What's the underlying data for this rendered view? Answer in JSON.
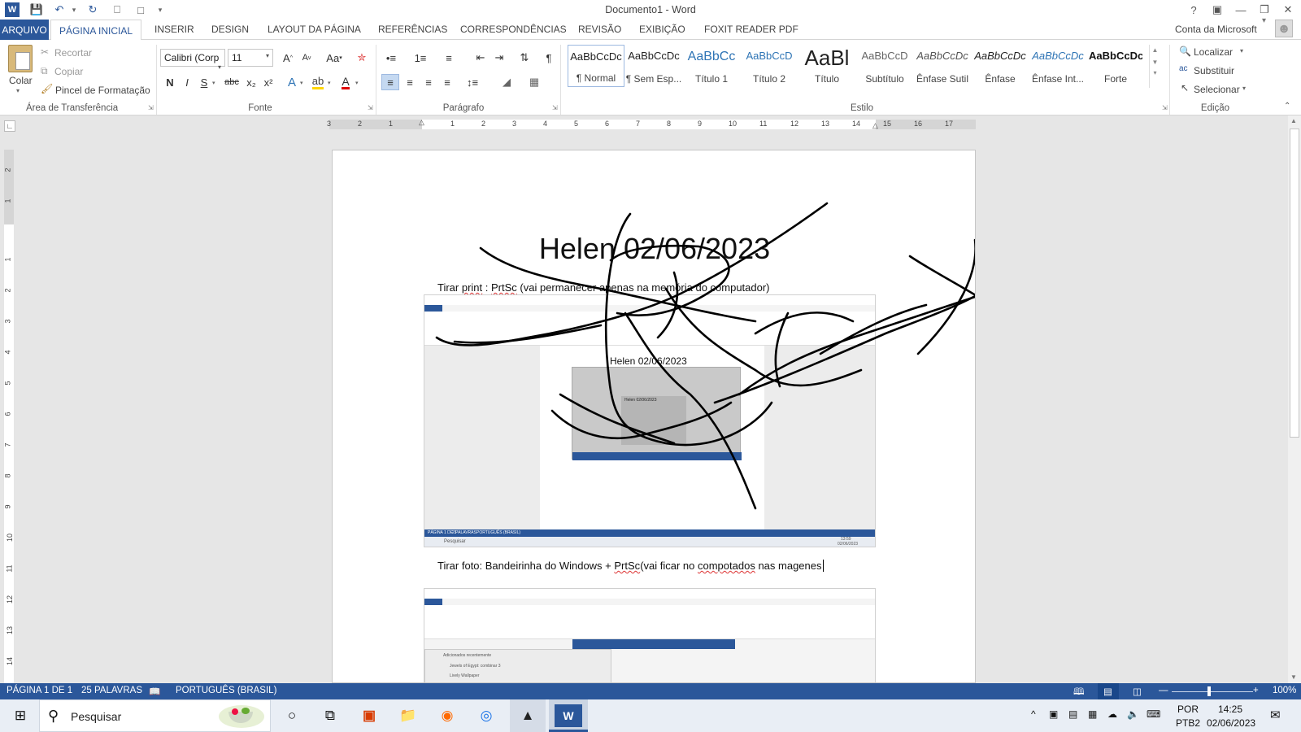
{
  "window": {
    "title": "Documento1 - Word",
    "help": "?",
    "qat": [
      "word-icon",
      "save-icon",
      "undo-icon",
      "redo-icon",
      "print-preview-icon",
      "new-doc-icon",
      "customize-icon"
    ]
  },
  "tabs": {
    "arquivo": "ARQUIVO",
    "items": [
      "PÁGINA INICIAL",
      "INSERIR",
      "DESIGN",
      "LAYOUT DA PÁGINA",
      "REFERÊNCIAS",
      "CORRESPONDÊNCIAS",
      "REVISÃO",
      "EXIBIÇÃO",
      "FOXIT READER PDF"
    ],
    "account": "Conta da Microsoft"
  },
  "ribbon": {
    "clipboard": {
      "paste": "Colar",
      "cut": "Recortar",
      "copy": "Copiar",
      "format_painter": "Pincel de Formatação",
      "group": "Área de Transferência"
    },
    "font": {
      "name": "Calibri (Corp",
      "size": "11",
      "bold": "N",
      "italic": "I",
      "underline": "S",
      "strike": "abc",
      "sub": "x₂",
      "sup": "x²",
      "case": "Aa",
      "group": "Fonte"
    },
    "paragraph": {
      "group": "Parágrafo"
    },
    "styles": {
      "group": "Estilo",
      "items": [
        {
          "sample": "AaBbCcDc",
          "name": "¶ Normal",
          "color": "#222222"
        },
        {
          "sample": "AaBbCcDc",
          "name": "¶ Sem Esp...",
          "color": "#222222"
        },
        {
          "sample": "AaBbCc",
          "name": "Título 1",
          "color": "#2e74b5"
        },
        {
          "sample": "AaBbCcD",
          "name": "Título 2",
          "color": "#2e74b5"
        },
        {
          "sample": "AaBl",
          "name": "Título",
          "color": "#222222"
        },
        {
          "sample": "AaBbCcD",
          "name": "Subtítulo",
          "color": "#666666"
        },
        {
          "sample": "AaBbCcDc",
          "name": "Ênfase Sutil",
          "color": "#555555"
        },
        {
          "sample": "AaBbCcDc",
          "name": "Ênfase",
          "color": "#222222"
        },
        {
          "sample": "AaBbCcDc",
          "name": "Ênfase Int...",
          "color": "#2e74b5"
        },
        {
          "sample": "AaBbCcDc",
          "name": "Forte",
          "color": "#111111"
        }
      ]
    },
    "editing": {
      "find": "Localizar",
      "replace": "Substituir",
      "select": "Selecionar",
      "group": "Edição"
    }
  },
  "ruler": {
    "h_ticks": [
      "3",
      "2",
      "1",
      "1",
      "2",
      "3",
      "4",
      "5",
      "6",
      "7",
      "8",
      "9",
      "10",
      "11",
      "12",
      "13",
      "14",
      "15",
      "16",
      "17"
    ],
    "v_ticks": [
      "2",
      "1",
      "1",
      "2",
      "3",
      "4",
      "5",
      "6",
      "7",
      "8",
      "9",
      "10",
      "11",
      "12",
      "13",
      "14"
    ]
  },
  "document": {
    "title": "Helen 02/06/2023",
    "line1_prefix": "Tirar ",
    "line1_print": "print",
    "line1_mid": " : ",
    "line1_prtsc": "PrtSc",
    "line1_rest": " (vai permanecer apenas na memória do computador)",
    "line2_prefix": "Tirar foto: Bandeirinha do Windows + ",
    "line2_prtsc": "PrtSc",
    "line2_mid": "(vai ficar no ",
    "line2_comp": "compotados",
    "line2_rest": " nas magenes",
    "embedded_title": "Helen 02/06/2023",
    "embedded_inner_title": "Helen 02/06/2023",
    "embedded_status": [
      "PÁGINA 1 DE 1",
      "2 PALAVRAS",
      "PORTUGUÊS (BRASIL)"
    ],
    "embedded_search": "Pesquisar",
    "embedded_time": "13:59",
    "embedded_date": "02/06/2023",
    "embedded2_panel": "Adicionados recentemente",
    "embedded2_items": [
      "Jewels of Egypt: combinar 3",
      "Lively Wallpaper"
    ]
  },
  "status": {
    "page": "PÁGINA 1 DE 1",
    "words": "25 PALAVRAS",
    "lang": "PORTUGUÊS (BRASIL)",
    "zoom": "100%",
    "zoom_level": 1.0
  },
  "taskbar": {
    "search": "Pesquisar",
    "apps": [
      "task-view-icon",
      "office-icon",
      "file-explorer-icon",
      "firefox-icon",
      "chrome-icon",
      "app-icon",
      "word-icon"
    ],
    "lang1": "POR",
    "lang2": "PTB2",
    "time": "14:25",
    "date": "02/06/2023"
  }
}
